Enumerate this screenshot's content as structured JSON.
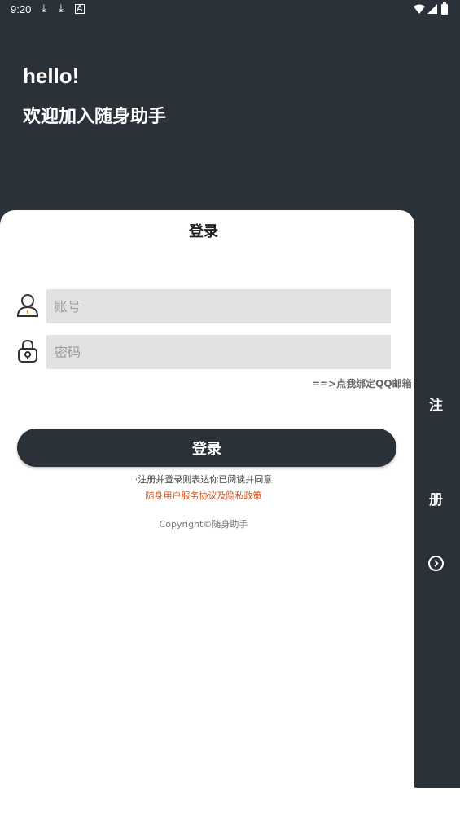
{
  "status_bar": {
    "time": "9:20",
    "left_icons": [
      "download-icon",
      "download-icon",
      "a-icon"
    ],
    "right_icons": [
      "wifi-icon",
      "signal-icon",
      "battery-icon"
    ]
  },
  "welcome": {
    "hello": "hello!",
    "subtitle": "欢迎加入随身助手"
  },
  "login": {
    "title": "登录",
    "account_placeholder": "账号",
    "password_placeholder": "密码",
    "bind_link": "==>点我绑定QQ邮箱",
    "button_label": "登录",
    "agreement_text": "·注册并登录则表达你已阅读并同意",
    "policy_link": "随身用户服务协议及隐私政策",
    "copyright": "Copyright©随身助手"
  },
  "register_panel": {
    "char1": "注",
    "char2": "册"
  },
  "colors": {
    "dark": "#2a3138",
    "field_bg": "#e2e2e2",
    "link_orange": "#d9541e",
    "icon_orange": "#f0a030"
  }
}
